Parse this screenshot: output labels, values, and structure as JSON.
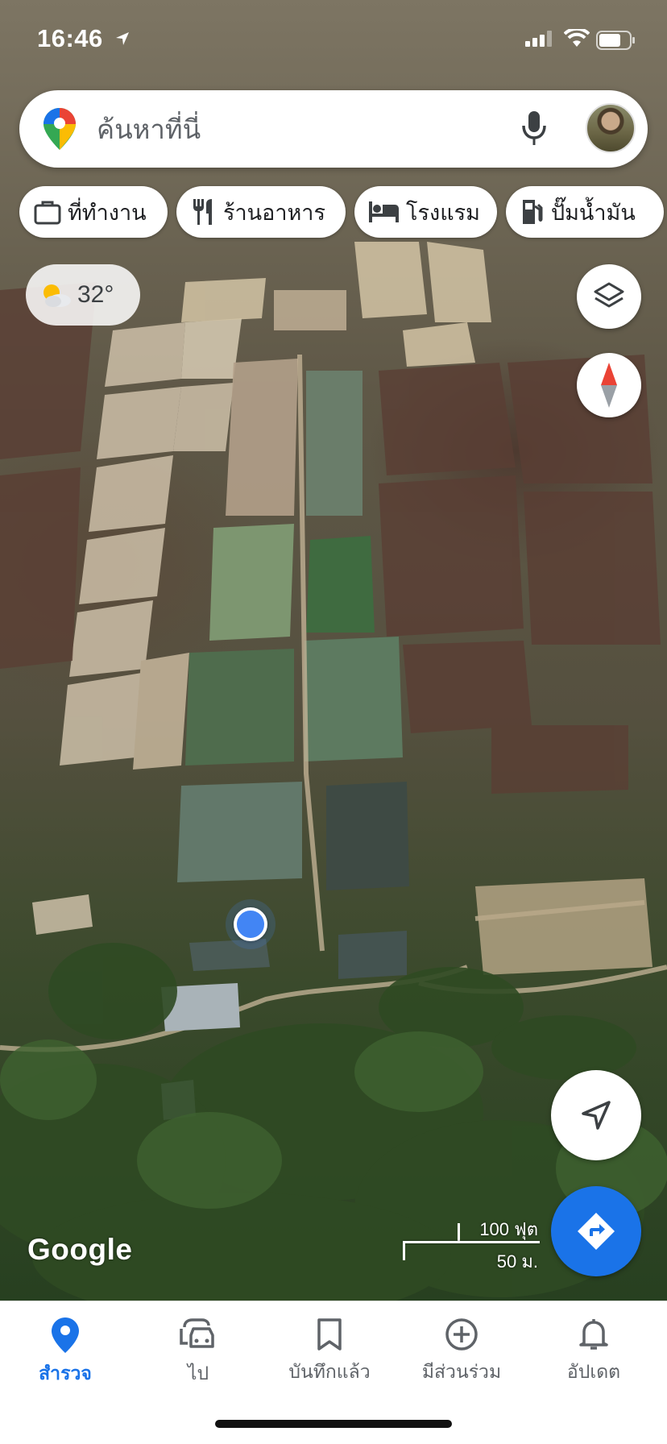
{
  "status_bar": {
    "time": "16:46"
  },
  "search": {
    "placeholder": "ค้นหาที่นี่"
  },
  "chips": [
    {
      "label": "ที่ทำงาน",
      "icon": "briefcase-icon"
    },
    {
      "label": "ร้านอาหาร",
      "icon": "restaurant-icon"
    },
    {
      "label": "โรงแรม",
      "icon": "hotel-icon"
    },
    {
      "label": "ปั๊มน้ำมัน",
      "icon": "gas-station-icon"
    }
  ],
  "weather": {
    "temperature": "32°",
    "icon": "partly-cloudy-icon"
  },
  "map": {
    "attribution": "Google",
    "scale_ft": "100 ฟุต",
    "scale_m": "50 ม."
  },
  "bottom_nav": [
    {
      "label": "สำรวจ",
      "icon": "explore-pin-icon",
      "active": true
    },
    {
      "label": "ไป",
      "icon": "car-icon",
      "active": false
    },
    {
      "label": "บันทึกแล้ว",
      "icon": "bookmark-icon",
      "active": false
    },
    {
      "label": "มีส่วนร่วม",
      "icon": "add-circle-icon",
      "active": false
    },
    {
      "label": "อัปเดต",
      "icon": "bell-icon",
      "active": false
    }
  ],
  "colors": {
    "accent": "#1a73e8",
    "location_dot": "#4285f4"
  }
}
